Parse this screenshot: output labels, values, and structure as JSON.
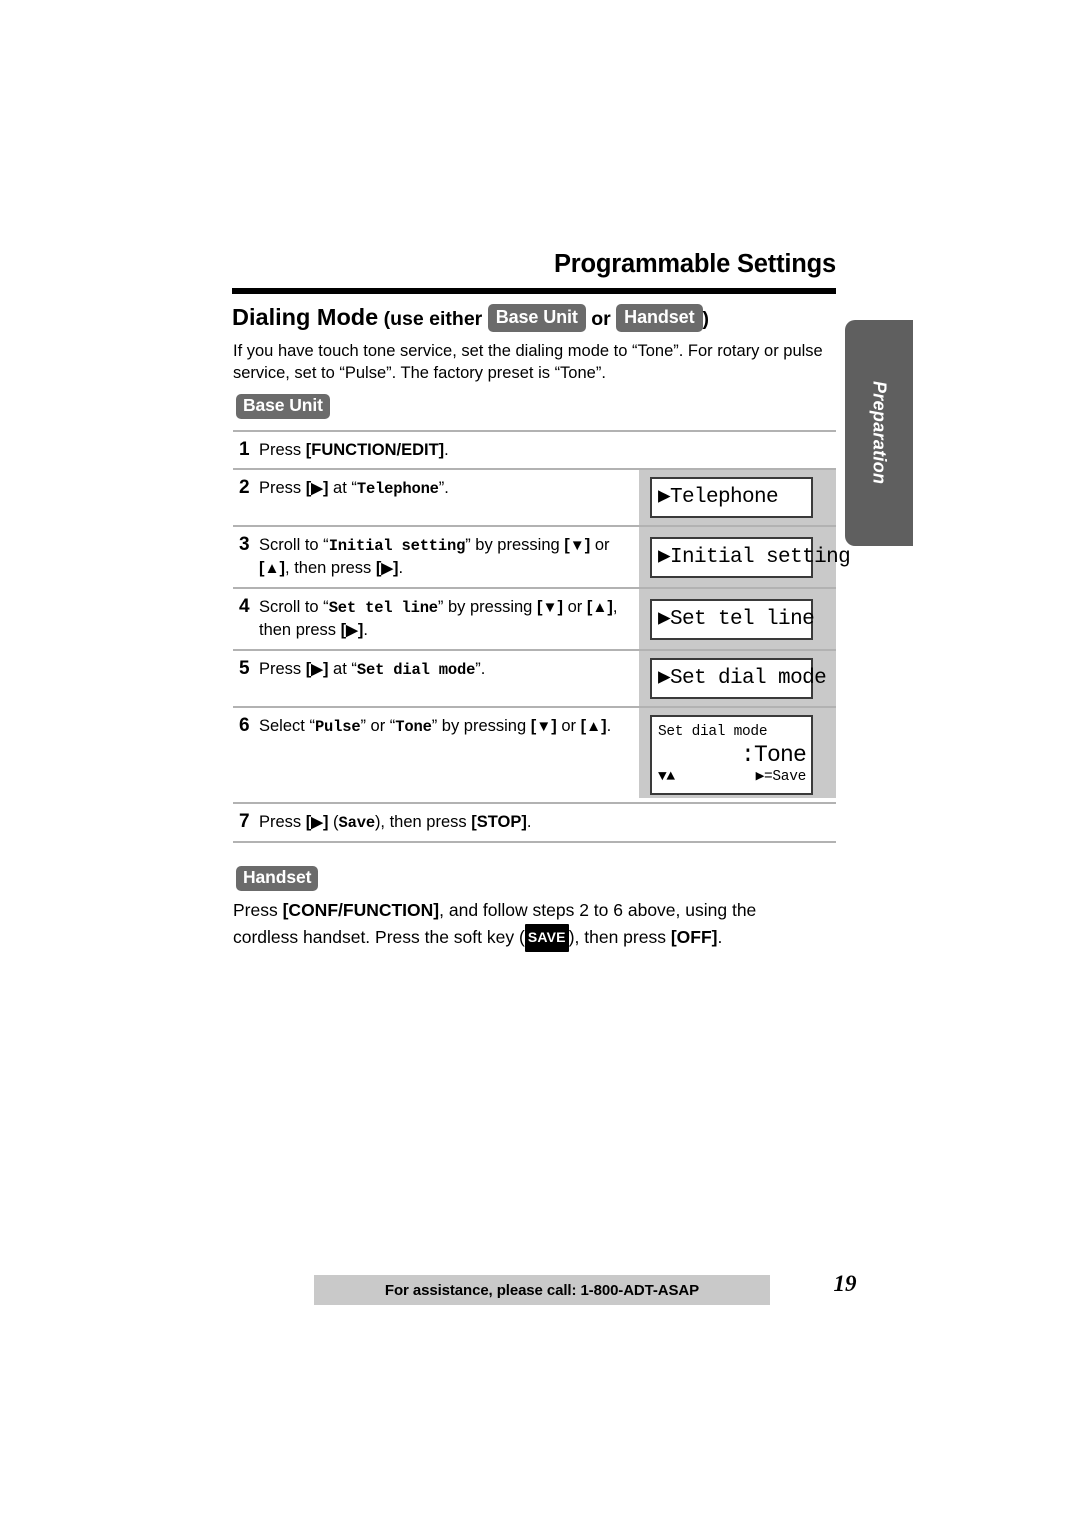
{
  "header": {
    "chapter_title": "Programmable Settings"
  },
  "section": {
    "title": "Dialing Mode",
    "subtitle_prefix": "(use either",
    "badge_base_unit": "Base Unit",
    "subtitle_or": "or",
    "badge_handset": "Handset",
    "subtitle_suffix": ")",
    "intro": "If you have touch tone service, set the dialing mode to “Tone”. For rotary or pulse service, set to “Pulse”. The factory preset is “Tone”."
  },
  "side_tab": {
    "label": "Preparation"
  },
  "base_unit_group": {
    "label": "Base Unit",
    "steps": [
      {
        "num": "1",
        "text_html": "Press <b>[FUNCTION/EDIT]</b>.",
        "lcd": null
      },
      {
        "num": "2",
        "text_html": "Press <b>[<span class=\"tri\">▶</span>]</b> at “<span class=\"mono\">Telephone</span>”.",
        "lcd": {
          "type": "single",
          "line": "▶Telephone"
        }
      },
      {
        "num": "3",
        "text_html": "Scroll to “<span class=\"mono\">Initial setting</span>” by pressing <b>[<span class=\"tri\">▼</span>]</b> or <b>[<span class=\"tri\">▲</span>]</b>, then press <b>[<span class=\"tri\">▶</span>]</b>.",
        "lcd": {
          "type": "single",
          "line": "▶Initial setting"
        }
      },
      {
        "num": "4",
        "text_html": "Scroll to “<span class=\"mono\">Set tel line</span>” by pressing <b>[<span class=\"tri\">▼</span>]</b> or <b>[<span class=\"tri\">▲</span>]</b>, then press <b>[<span class=\"tri\">▶</span>]</b>.",
        "lcd": {
          "type": "single",
          "line": "▶Set tel line"
        }
      },
      {
        "num": "5",
        "text_html": "Press <b>[<span class=\"tri\">▶</span>]</b> at “<span class=\"mono\">Set dial mode</span>”.",
        "lcd": {
          "type": "single",
          "line": "▶Set dial mode"
        }
      },
      {
        "num": "6",
        "text_html": "Select “<span class=\"mono\">Pulse</span>” or “<span class=\"mono\">Tone</span>” by pressing <b>[<span class=\"tri\">▼</span>]</b> or <b>[<span class=\"tri\">▲</span>]</b>.",
        "lcd": {
          "type": "multi",
          "title": "Set dial mode",
          "value": ":Tone",
          "foot_left": "▼▲",
          "foot_right": "▶=Save"
        }
      },
      {
        "num": "7",
        "text_html": "Press <b>[<span class=\"tri\">▶</span>]</b> (<span class=\"mono\">Save</span>), then press <b>[STOP]</b>.",
        "lcd": null
      }
    ]
  },
  "handset_group": {
    "label": "Handset",
    "text_html": "Press <b>[CONF/FUNCTION]</b>, and follow steps 2 to 6 above, using the cordless handset. Press the soft key (<span class=\"softkey\">SAVE</span>), then press <b>[OFF]</b>."
  },
  "footer": {
    "assistance_text": "For assistance, please call: 1-800-ADT-ASAP",
    "page_number": "19"
  },
  "colors": {
    "badge_gray": "#6b6b6b",
    "tab_gray": "#5f5f5f",
    "footer_gray": "#c9c9c9",
    "lcd_column_gray": "#c9c9c9",
    "rule_gray": "#b2b2b2",
    "black": "#000000"
  }
}
